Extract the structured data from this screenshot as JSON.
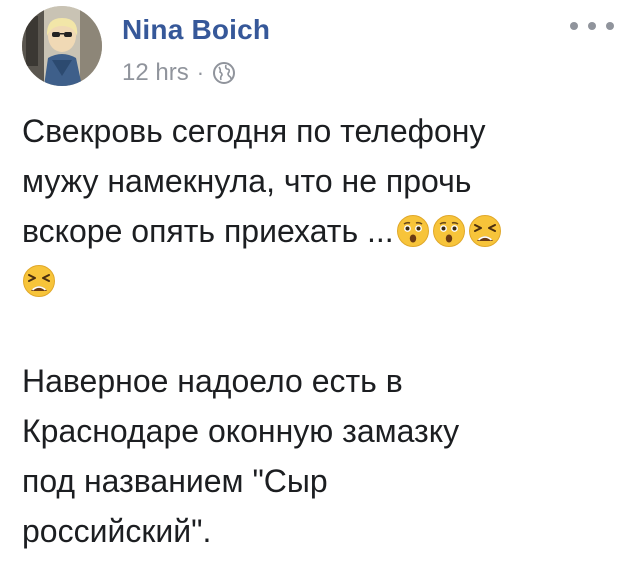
{
  "post": {
    "author": "Nina Boich",
    "timestamp": "12 hrs",
    "separator": "·",
    "privacy_icon": "globe-icon",
    "menu_icon": "more-horiz-icon",
    "paragraphs": [
      {
        "lines": [
          "Свекровь сегодня по телефону",
          "мужу намекнула, что не прочь",
          "вскоре опять приехать ..."
        ],
        "trailing_emojis": [
          "astonished-face",
          "astonished-face",
          "tired-face",
          "tired-face"
        ]
      },
      {
        "lines": [
          "Наверное надоело есть в",
          "Краснодаре оконную замазку",
          "под названием \"Сыр",
          "российский\"."
        ]
      }
    ]
  },
  "colors": {
    "author_link": "#365899",
    "meta_gray": "#90949c",
    "text": "#1c1e21",
    "emoji_yellow": "#f7c43a"
  }
}
